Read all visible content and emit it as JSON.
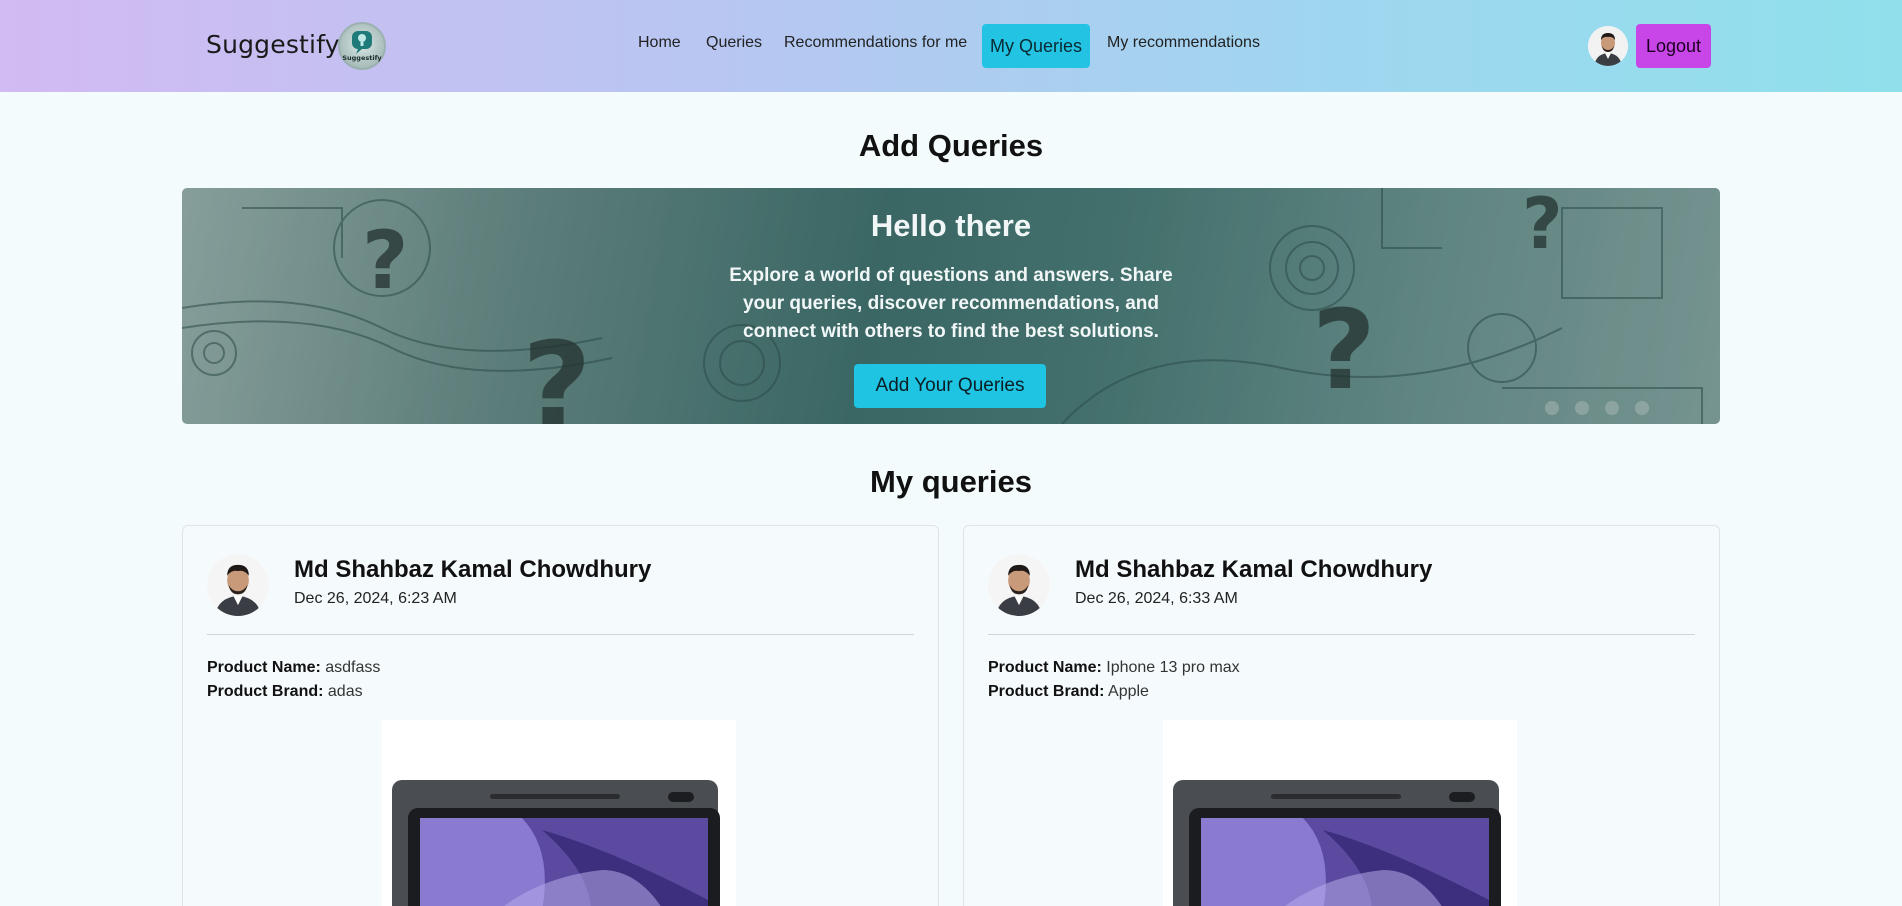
{
  "navbar": {
    "brand": "Suggestify",
    "logo_text": "Suggestify",
    "links": [
      "Home",
      "Queries",
      "Recommendations for me",
      "My Queries",
      "My recommendations"
    ],
    "active_link": "My Queries",
    "logout_label": "Logout"
  },
  "add_section": {
    "title": "Add Queries"
  },
  "hero": {
    "title": "Hello there",
    "text": "Explore a world of questions and answers. Share your queries, discover recommendations, and connect with others to find the best solutions.",
    "button_label": "Add Your Queries"
  },
  "my_section": {
    "title": "My queries"
  },
  "queries": [
    {
      "author": "Md Shahbaz Kamal Chowdhury",
      "date": "Dec 26, 2024, 6:23 AM",
      "product_name_label": "Product Name:",
      "product_name": "asdfass",
      "product_brand_label": "Product Brand:",
      "product_brand": "adas"
    },
    {
      "author": "Md Shahbaz Kamal Chowdhury",
      "date": "Dec 26, 2024, 6:33 AM",
      "product_name_label": "Product Name:",
      "product_name": "Iphone 13 pro max",
      "product_brand_label": "Product Brand:",
      "product_brand": "Apple"
    }
  ]
}
